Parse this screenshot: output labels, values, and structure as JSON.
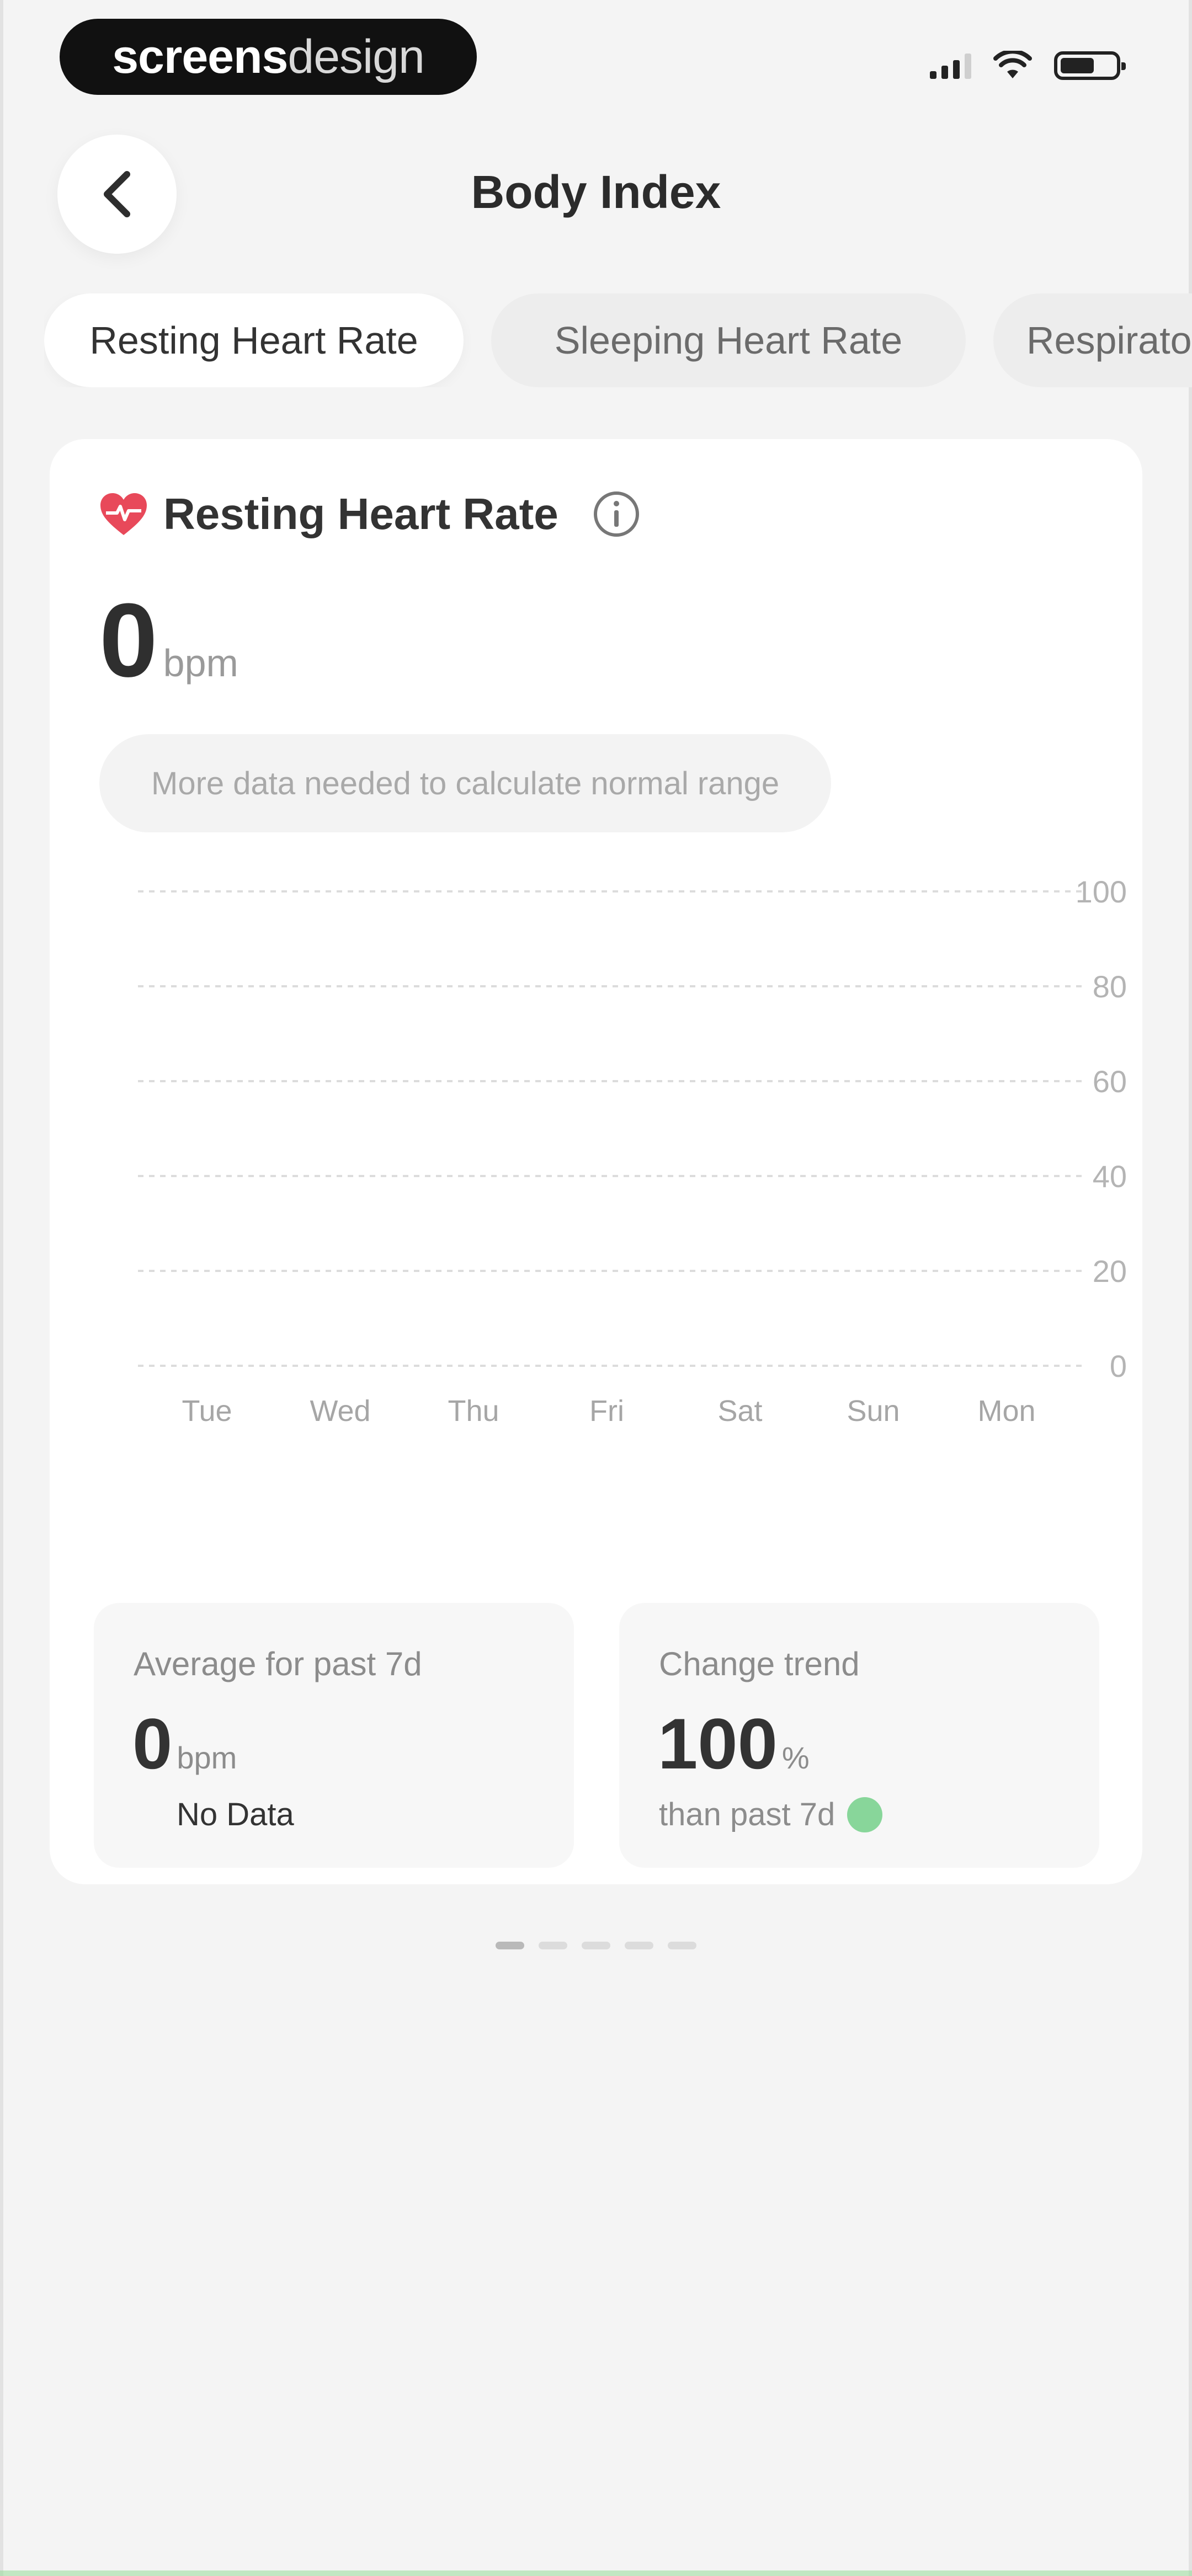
{
  "brand": {
    "part1": "screens",
    "part2": "design"
  },
  "header": {
    "title": "Body Index",
    "back_label": "Back"
  },
  "tabs": [
    "Resting Heart Rate",
    "Sleeping Heart Rate",
    "Respiratory"
  ],
  "card": {
    "title": "Resting Heart Rate",
    "value": "0",
    "unit": "bpm",
    "note": "More data needed to calculate normal range"
  },
  "chart_data": {
    "type": "bar",
    "categories": [
      "Tue",
      "Wed",
      "Thu",
      "Fri",
      "Sat",
      "Sun",
      "Mon"
    ],
    "values": [
      0,
      0,
      0,
      0,
      0,
      0,
      0
    ],
    "yticks": [
      100,
      80,
      60,
      40,
      20,
      0
    ],
    "ylim": [
      0,
      100
    ],
    "grid": true
  },
  "stats": {
    "average": {
      "label": "Average for past 7d",
      "value": "0",
      "unit": "bpm",
      "sub": "No Data"
    },
    "trend": {
      "label": "Change trend",
      "value": "100",
      "unit": "%",
      "sub": "than past 7d"
    }
  },
  "pagination": {
    "count": 5,
    "active": 0
  },
  "colors": {
    "heart": "#e8495a",
    "trend_dot": "#88d69a",
    "card_bg": "#ffffff",
    "page_bg": "#f4f4f4"
  },
  "icons": {
    "back": "chevron-left-icon",
    "heart": "heart-icon",
    "info": "info-icon",
    "signal": "signal-icon",
    "wifi": "wifi-icon",
    "battery": "battery-icon"
  }
}
